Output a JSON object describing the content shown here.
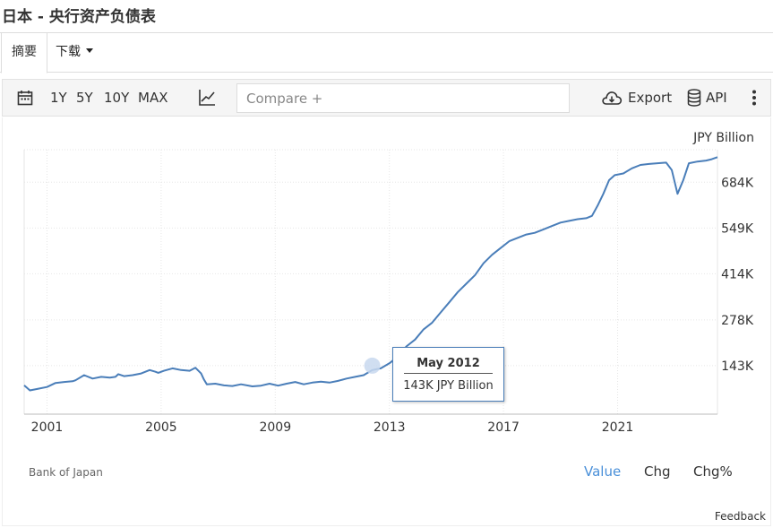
{
  "title": "日本 - 央行资产负债表",
  "tabs": {
    "summary": "摘要",
    "download": "下载"
  },
  "toolbar": {
    "ranges": [
      "1Y",
      "5Y",
      "10Y",
      "MAX"
    ],
    "compare_placeholder": "Compare +",
    "export_label": "Export",
    "api_label": "API"
  },
  "icons": {
    "date": "calendar-icon",
    "chart_type": "line-chart-icon",
    "export": "cloud-download-icon",
    "api": "database-icon",
    "more": "more-vertical-icon"
  },
  "colors": {
    "series": "#4a7eb9",
    "highlight": "#4a90d9",
    "grid": "#e6e6e6"
  },
  "chart_data": {
    "type": "line",
    "unit_label": "JPY Billion",
    "x_ticks": [
      "2001",
      "2005",
      "2009",
      "2013",
      "2017",
      "2021"
    ],
    "y_ticks": [
      "143K",
      "278K",
      "414K",
      "549K",
      "684K"
    ],
    "xlim": [
      2000.2,
      2024.5
    ],
    "ylim": [
      0,
      780
    ],
    "grid": true,
    "x": [
      2000.2,
      2000.4,
      2000.7,
      2001.0,
      2001.3,
      2001.6,
      2001.9,
      2002.0,
      2002.3,
      2002.6,
      2002.9,
      2003.2,
      2003.4,
      2003.5,
      2003.7,
      2004.0,
      2004.3,
      2004.6,
      2004.8,
      2004.9,
      2005.1,
      2005.4,
      2005.7,
      2006.0,
      2006.2,
      2006.4,
      2006.5,
      2006.6,
      2006.9,
      2007.2,
      2007.5,
      2007.8,
      2008.2,
      2008.5,
      2008.8,
      2009.1,
      2009.4,
      2009.7,
      2010.0,
      2010.3,
      2010.6,
      2010.9,
      2011.2,
      2011.5,
      2011.8,
      2012.1,
      2012.4,
      2012.7,
      2013.0,
      2013.3,
      2013.6,
      2013.9,
      2014.2,
      2014.5,
      2014.8,
      2015.1,
      2015.4,
      2015.7,
      2016.0,
      2016.3,
      2016.6,
      2016.9,
      2017.2,
      2017.5,
      2017.8,
      2018.1,
      2018.4,
      2018.7,
      2019.0,
      2019.3,
      2019.6,
      2019.9,
      2020.1,
      2020.3,
      2020.5,
      2020.7,
      2020.9,
      2021.2,
      2021.5,
      2021.8,
      2022.1,
      2022.4,
      2022.7,
      2022.9,
      2023.1,
      2023.3,
      2023.5,
      2023.8,
      2024.1,
      2024.3,
      2024.5
    ],
    "values": [
      85,
      70,
      75,
      80,
      92,
      95,
      97,
      100,
      115,
      105,
      110,
      108,
      110,
      118,
      112,
      115,
      120,
      130,
      125,
      122,
      128,
      135,
      130,
      128,
      137,
      120,
      102,
      88,
      90,
      85,
      83,
      88,
      82,
      84,
      90,
      84,
      90,
      95,
      88,
      93,
      96,
      93,
      98,
      105,
      110,
      115,
      130,
      135,
      150,
      170,
      200,
      220,
      250,
      270,
      300,
      330,
      360,
      385,
      410,
      445,
      470,
      490,
      510,
      520,
      530,
      535,
      545,
      555,
      565,
      570,
      575,
      578,
      585,
      615,
      650,
      690,
      705,
      710,
      725,
      735,
      738,
      740,
      742,
      720,
      650,
      690,
      740,
      745,
      748,
      752,
      758
    ]
  },
  "tooltip": {
    "date": "May 2012",
    "value": "143K JPY Billion"
  },
  "footer": {
    "source": "Bank of Japan",
    "value_tabs": [
      "Value",
      "Chg",
      "Chg%"
    ],
    "feedback": "Feedback"
  }
}
